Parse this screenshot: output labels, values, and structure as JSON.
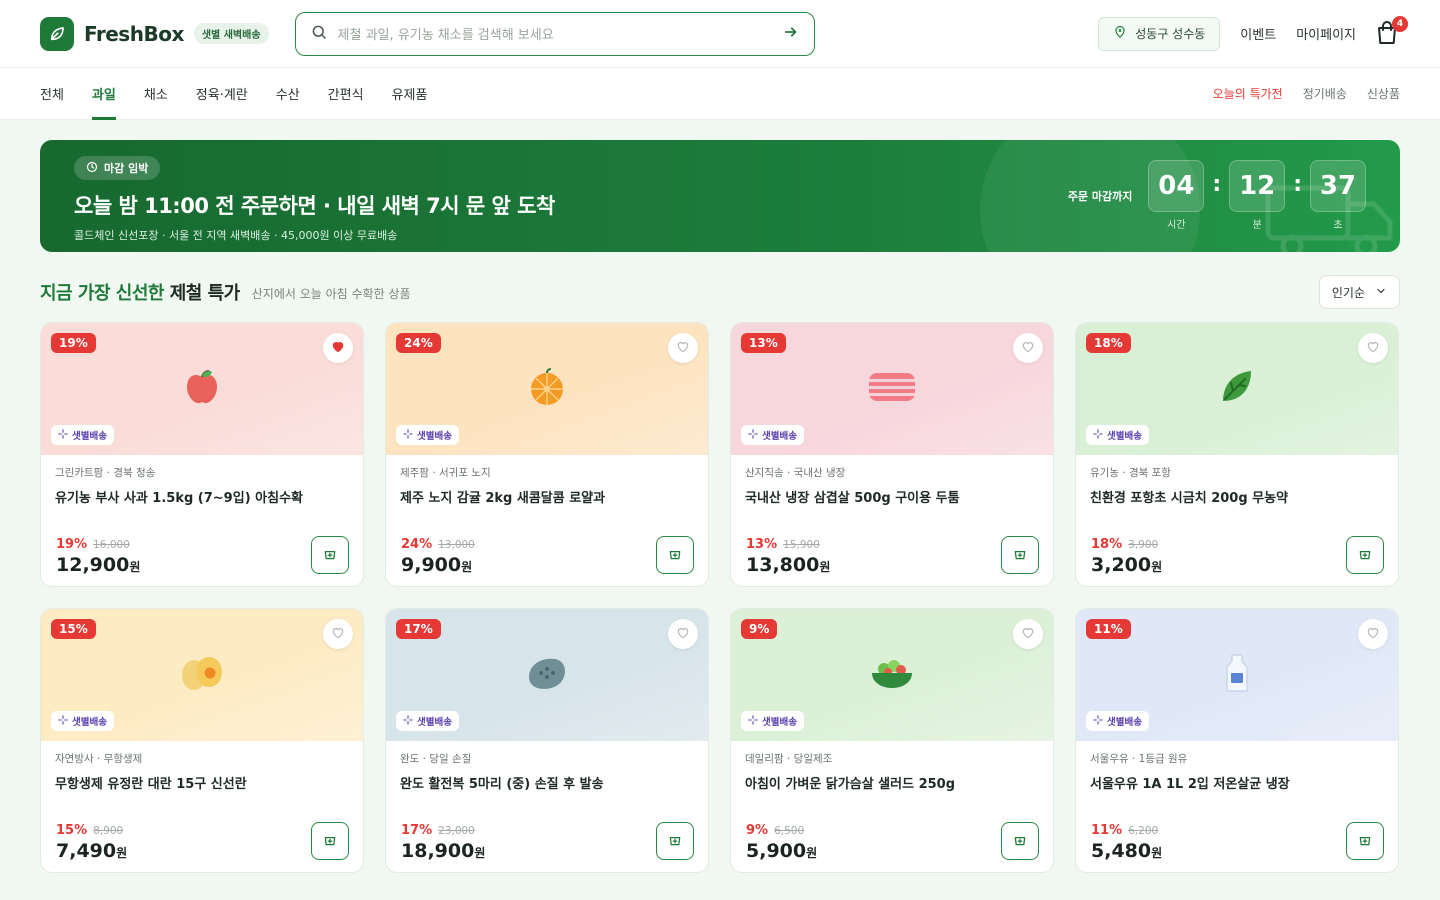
{
  "brand": {
    "name": "FreshBox",
    "tag": "샛별 새벽배송"
  },
  "search": {
    "placeholder": "제철 과일, 유기농 채소를 검색해 보세요"
  },
  "header": {
    "location": "성동구 성수동",
    "events": "이벤트",
    "mypage": "마이페이지",
    "cart_count": "4"
  },
  "categories": [
    "전체",
    "과일",
    "채소",
    "정육·계란",
    "수산",
    "간편식",
    "유제품"
  ],
  "active_category": "과일",
  "nav_right": {
    "deals": "오늘의 특가전",
    "subscription": "정기배송",
    "new": "신상품"
  },
  "banner": {
    "pill": "마감 임박",
    "title": "오늘 밤 11:00 전 주문하면 · 내일 새벽 7시 문 앞 도착",
    "subtitle": "콜드체인 신선포장 · 서울 전 지역 새벽배송 · 45,000원 이상 무료배송",
    "timer_label": "주문 마감까지",
    "hours": "04",
    "minutes": "12",
    "seconds": "37",
    "hours_unit": "시간",
    "minutes_unit": "분",
    "seconds_unit": "초"
  },
  "section": {
    "title_green": "지금 가장 신선한",
    "title_rest": "제철 특가",
    "subtitle": "산지에서 오늘 아침 수확한 상품",
    "sort": "인기순"
  },
  "colors": {
    "primary": "#1f7a3a",
    "discount": "#e53935",
    "dawn_chip": "#5a3fb0"
  },
  "products": [
    {
      "discount": "19%",
      "dawn": "샛별배송",
      "origin": "그린카트팜 · 경북 청송",
      "name": "유기농 부사 사과 1.5kg (7~9입) 아침수확",
      "pct": "19%",
      "orig": "16,000",
      "price": "12,900",
      "won": "원",
      "liked": true,
      "icon": "apple-icon",
      "bg": "#fadcd8"
    },
    {
      "discount": "24%",
      "dawn": "샛별배송",
      "origin": "제주팜 · 서귀포 노지",
      "name": "제주 노지 감귤 2kg 새콤달콤 로얄과",
      "pct": "24%",
      "orig": "13,000",
      "price": "9,900",
      "won": "원",
      "liked": false,
      "icon": "orange-icon",
      "bg": "#fde3c0"
    },
    {
      "discount": "13%",
      "dawn": "샛별배송",
      "origin": "산지직송 · 국내산 냉장",
      "name": "국내산 냉장 삼겹살 500g 구이용 두툼",
      "pct": "13%",
      "orig": "15,900",
      "price": "13,800",
      "won": "원",
      "liked": false,
      "icon": "pork-belly-icon",
      "bg": "#f7d6dc"
    },
    {
      "discount": "18%",
      "dawn": "샛별배송",
      "origin": "유기농 · 경북 포항",
      "name": "친환경 포항초 시금치 200g 무농약",
      "pct": "18%",
      "orig": "3,900",
      "price": "3,200",
      "won": "원",
      "liked": false,
      "icon": "spinach-icon",
      "bg": "#d9efd6"
    },
    {
      "discount": "15%",
      "dawn": "샛별배송",
      "origin": "자연방사 · 무항생제",
      "name": "무항생제 유정란 대란 15구 신선란",
      "pct": "15%",
      "orig": "8,900",
      "price": "7,490",
      "won": "원",
      "liked": false,
      "icon": "egg-icon",
      "bg": "#fdebc4"
    },
    {
      "discount": "17%",
      "dawn": "샛별배송",
      "origin": "완도 · 당일 손질",
      "name": "완도 활전복 5마리 (중) 손질 후 발송",
      "pct": "17%",
      "orig": "23,000",
      "price": "18,900",
      "won": "원",
      "liked": false,
      "icon": "abalone-icon",
      "bg": "#d7e4ea"
    },
    {
      "discount": "9%",
      "dawn": "샛별배송",
      "origin": "데일리팜 · 당일제조",
      "name": "아침이 가벼운 닭가슴살 샐러드 250g",
      "pct": "9%",
      "orig": "6,500",
      "price": "5,900",
      "won": "원",
      "liked": false,
      "icon": "salad-icon",
      "bg": "#dcf0d8"
    },
    {
      "discount": "11%",
      "dawn": "샛별배송",
      "origin": "서울우유 · 1등급 원유",
      "name": "서울우유 1A 1L 2입 저온살균 냉장",
      "pct": "11%",
      "orig": "6,200",
      "price": "5,480",
      "won": "원",
      "liked": false,
      "icon": "milk-icon",
      "bg": "#e0e8f7"
    }
  ]
}
